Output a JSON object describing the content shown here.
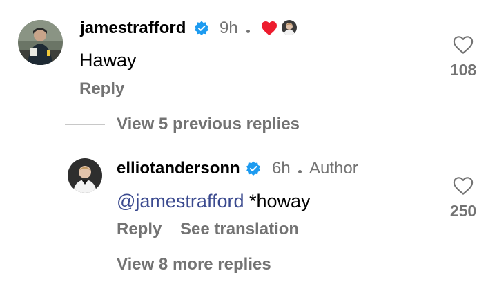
{
  "colors": {
    "muted_text": "#737373",
    "verified_badge": "#1d9bf0",
    "mention_link": "#3b4a8f",
    "heart_red": "#ed1c2e"
  },
  "comment": {
    "username": "jamestrafford",
    "timestamp": "9h",
    "text": "Haway",
    "reply_label": "Reply",
    "like_count": "108",
    "icons": [
      "verified-badge-icon",
      "author-liked-heart-icon",
      "author-mini-avatar",
      "like-heart-icon"
    ]
  },
  "view_previous": {
    "label": "View 5 previous replies"
  },
  "reply": {
    "username": "elliotandersonn",
    "timestamp": "6h",
    "author_label": "Author",
    "mention": "@jamestrafford",
    "text": " *howay",
    "reply_label": "Reply",
    "translation_label": "See translation",
    "like_count": "250",
    "icons": [
      "verified-badge-icon",
      "like-heart-icon"
    ]
  },
  "view_more": {
    "label": "View 8 more replies"
  }
}
